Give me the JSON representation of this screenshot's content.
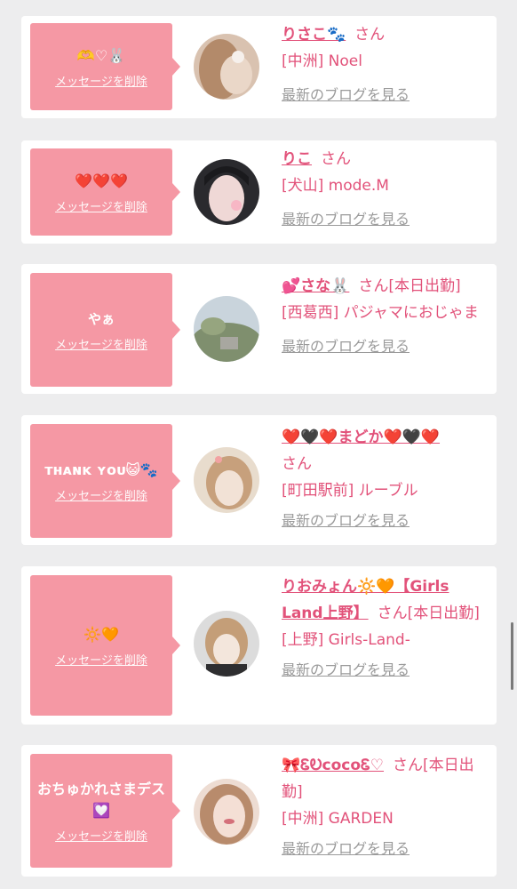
{
  "cards": [
    {
      "message": "🫶♡🐰",
      "delete_label": "メッセージを削除",
      "name": "りさこ🐾",
      "honorific": "さん",
      "status": "",
      "shop": "[中洲] Noel",
      "blog_label": "最新のブログを見る"
    },
    {
      "message": "❤️❤️❤️",
      "delete_label": "メッセージを削除",
      "name": "りこ",
      "honorific": "さん",
      "status": "",
      "shop": "[犬山] mode.M",
      "blog_label": "最新のブログを見る"
    },
    {
      "message": "やぁ",
      "delete_label": "メッセージを削除",
      "name": "💕さな🐰",
      "honorific": "さん",
      "status": "[本日出勤]",
      "shop": "[西葛西] パジャマにおじゃま",
      "blog_label": "最新のブログを見る"
    },
    {
      "message": "ᴛʜᴀɴᴋ ʏᴏᴜ😺🐾",
      "delete_label": "メッセージを削除",
      "name": "❤️🖤❤️まどか❤️🖤❤️",
      "honorific": "さん",
      "status": "",
      "shop": "[町田駅前] ルーブル",
      "blog_label": "最新のブログを見る"
    },
    {
      "message": "🔆🧡",
      "delete_label": "メッセージを削除",
      "name": "りおみょん🔆🧡【Girls Land上野】",
      "honorific": "さん",
      "status": "[本日出勤]",
      "shop": "[上野] Girls-Land-",
      "blog_label": "最新のブログを見る"
    },
    {
      "message": "おちゅかれさまデス💟",
      "delete_label": "メッセージを削除",
      "name": "🎀ᏋᎧcocoᏋ♡",
      "honorific": "さん",
      "status": "[本日出勤]",
      "shop": "[中洲] GARDEN",
      "blog_label": "最新のブログを見る"
    }
  ],
  "colors": {
    "bubble": "#f598a4",
    "name": "#e2527a",
    "link_gray": "#9a9a9a",
    "background": "#ededee"
  }
}
